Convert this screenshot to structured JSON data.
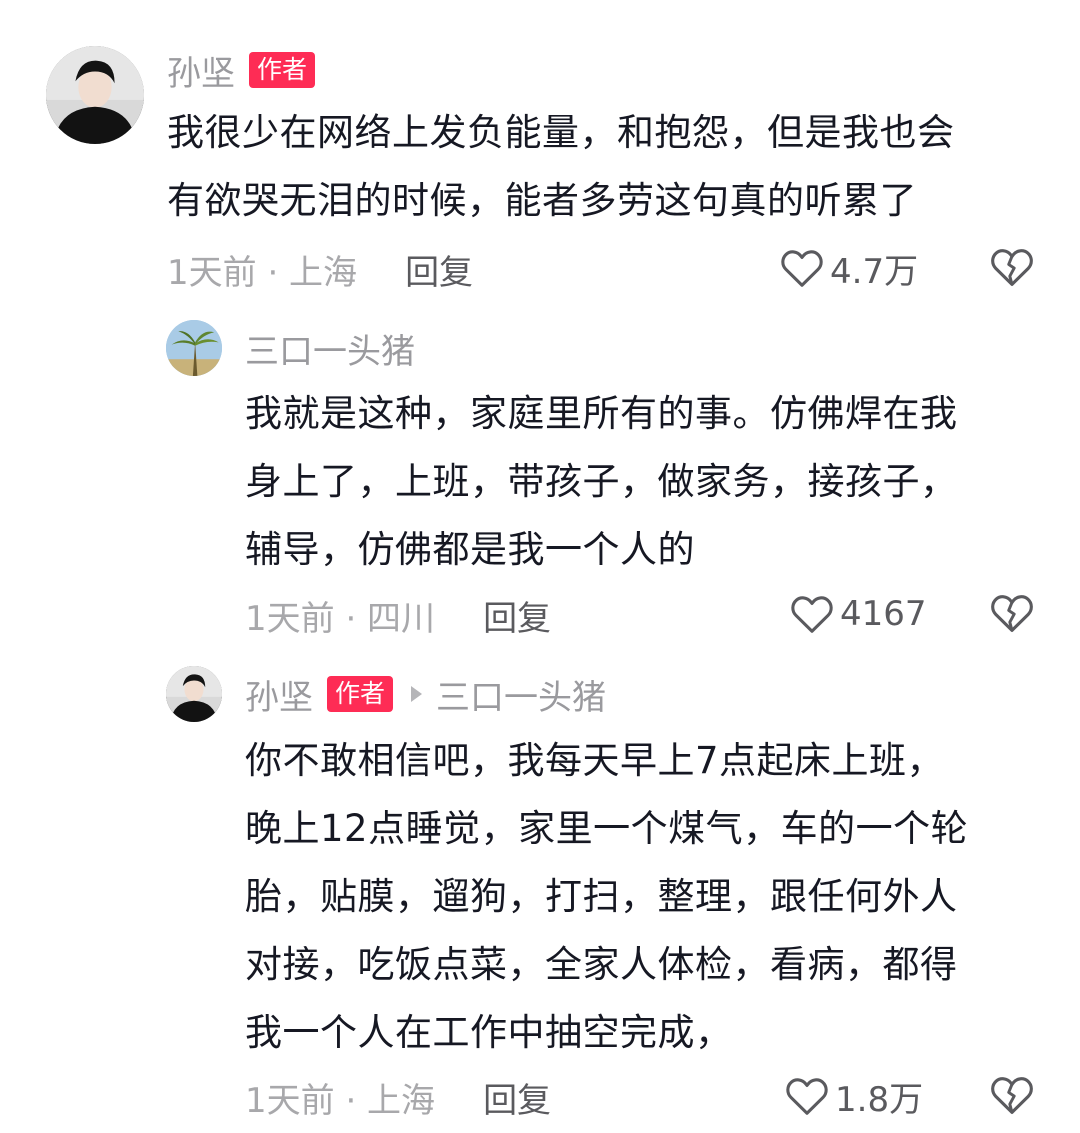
{
  "comments": [
    {
      "username": "孙坚",
      "author_tag": "作者",
      "avatar": "person-black-coat-avatar",
      "lines": [
        "我很少在网络上发负能量，和抱怨，但是我也会",
        "有欲哭无泪的时候，能者多劳这句真的听累了"
      ],
      "time_location": "1天前 · 上海",
      "reply_label": "回复",
      "like_count": "4.7万"
    },
    {
      "username": "三口一头猪",
      "avatar": "palm-tree-sky-avatar",
      "lines": [
        "我就是这种，家庭里所有的事。仿佛焊在我",
        "身上了，上班，带孩子，做家务，接孩子，",
        "辅导，仿佛都是我一个人的"
      ],
      "time_location": "1天前 · 四川",
      "reply_label": "回复",
      "like_count": "4167"
    },
    {
      "username": "孙坚",
      "author_tag": "作者",
      "reply_to": "三口一头猪",
      "avatar": "person-black-coat-avatar",
      "lines": [
        "你不敢相信吧，我每天早上7点起床上班，",
        "晚上12点睡觉，家里一个煤气，车的一个轮",
        "胎，贴膜，遛狗，打扫，整理，跟任何外人",
        "对接，吃饭点菜，全家人体检，看病，都得",
        "我一个人在工作中抽空完成，"
      ],
      "time_location": "1天前 · 上海",
      "reply_label": "回复",
      "like_count": "1.8万"
    }
  ],
  "icons": {
    "like": "heart-outline-icon",
    "dislike": "broken-heart-icon",
    "reply_arrow": "caret-right-icon"
  },
  "colors": {
    "author_tag_bg": "#fe2c55",
    "username": "#9a9a9e",
    "text": "#161823"
  }
}
